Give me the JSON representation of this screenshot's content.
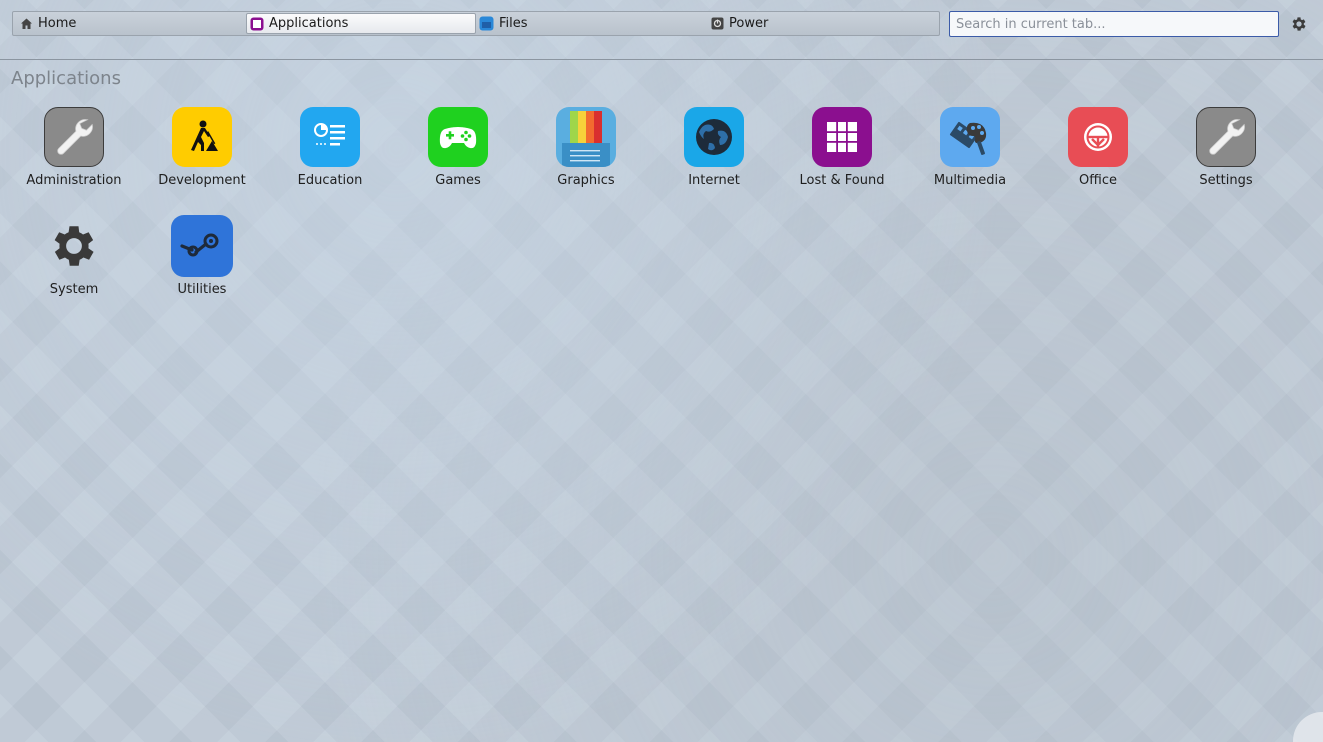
{
  "tabs": [
    {
      "label": "Home",
      "icon": "home-icon"
    },
    {
      "label": "Applications",
      "icon": "applications-icon",
      "active": true
    },
    {
      "label": "Files",
      "icon": "files-icon"
    },
    {
      "label": "Power",
      "icon": "power-icon"
    }
  ],
  "search": {
    "placeholder": "Search in current tab...",
    "value": ""
  },
  "settings_button_icon": "gear-icon",
  "section_title": "Applications",
  "apps": [
    {
      "label": "Administration",
      "icon": "wrench-icon",
      "color": "#8a8a8a"
    },
    {
      "label": "Development",
      "icon": "construction-worker-icon",
      "color": "#ffcc00"
    },
    {
      "label": "Education",
      "icon": "education-icon",
      "color": "#22a7f0"
    },
    {
      "label": "Games",
      "icon": "gamepad-icon",
      "color": "#1fd11f"
    },
    {
      "label": "Graphics",
      "icon": "graphics-icon",
      "color": "#5aaee0"
    },
    {
      "label": "Internet",
      "icon": "globe-icon",
      "color": "#1aa7e8"
    },
    {
      "label": "Lost & Found",
      "icon": "grid-icon",
      "color": "#8b0f8f"
    },
    {
      "label": "Multimedia",
      "icon": "multimedia-icon",
      "color": "#5ea9ef"
    },
    {
      "label": "Office",
      "icon": "office-icon",
      "color": "#e84d55"
    },
    {
      "label": "Settings",
      "icon": "wrench-icon",
      "color": "#8a8a8a"
    },
    {
      "label": "System",
      "icon": "gear-icon",
      "color": "#3a3a3a"
    },
    {
      "label": "Utilities",
      "icon": "utilities-icon",
      "color": "#2f74d9"
    }
  ]
}
